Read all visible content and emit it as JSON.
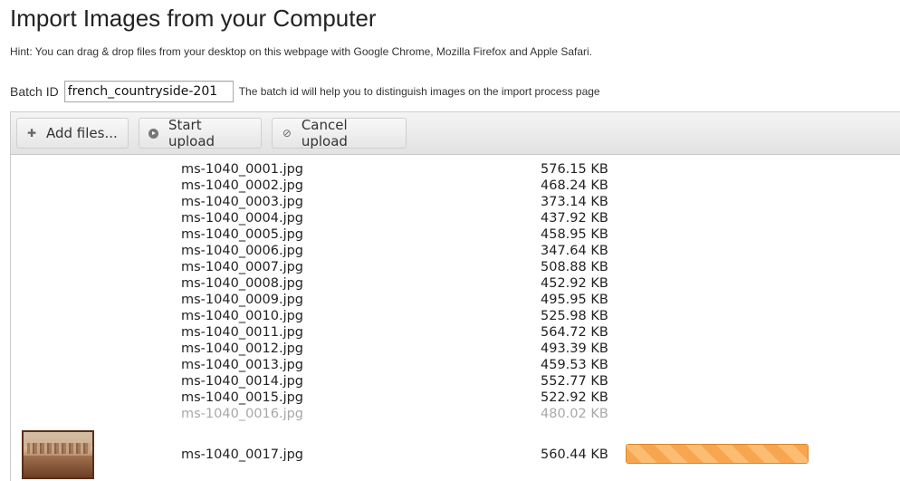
{
  "page": {
    "title": "Import Images from your Computer",
    "hint": "Hint: You can drag & drop files from your desktop on this webpage with Google Chrome, Mozilla Firefox and Apple Safari."
  },
  "batch": {
    "label": "Batch ID",
    "value": "french_countryside-201",
    "help": "The batch id will help you to distinguish images on the import process page"
  },
  "toolbar": {
    "add_label": "Add files...",
    "add_icon": "plus-icon",
    "start_label": "Start upload",
    "start_icon": "play-circle-icon",
    "cancel_label": "Cancel upload",
    "cancel_icon": "cancel-icon"
  },
  "files": [
    {
      "name": "ms-1040_0001.jpg",
      "size": "576.15 KB"
    },
    {
      "name": "ms-1040_0002.jpg",
      "size": "468.24 KB"
    },
    {
      "name": "ms-1040_0003.jpg",
      "size": "373.14 KB"
    },
    {
      "name": "ms-1040_0004.jpg",
      "size": "437.92 KB"
    },
    {
      "name": "ms-1040_0005.jpg",
      "size": "458.95 KB"
    },
    {
      "name": "ms-1040_0006.jpg",
      "size": "347.64 KB"
    },
    {
      "name": "ms-1040_0007.jpg",
      "size": "508.88 KB"
    },
    {
      "name": "ms-1040_0008.jpg",
      "size": "452.92 KB"
    },
    {
      "name": "ms-1040_0009.jpg",
      "size": "495.95 KB"
    },
    {
      "name": "ms-1040_0010.jpg",
      "size": "525.98 KB"
    },
    {
      "name": "ms-1040_0011.jpg",
      "size": "564.72 KB"
    },
    {
      "name": "ms-1040_0012.jpg",
      "size": "493.39 KB"
    },
    {
      "name": "ms-1040_0013.jpg",
      "size": "459.53 KB"
    },
    {
      "name": "ms-1040_0014.jpg",
      "size": "552.77 KB"
    },
    {
      "name": "ms-1040_0015.jpg",
      "size": "522.92 KB"
    },
    {
      "name": "ms-1040_0016.jpg",
      "size": "480.02 KB",
      "faded": true
    }
  ],
  "current_file": {
    "name": "ms-1040_0017.jpg",
    "size": "560.44 KB",
    "progress": 1.0,
    "progress_color": "#f7a64f"
  }
}
